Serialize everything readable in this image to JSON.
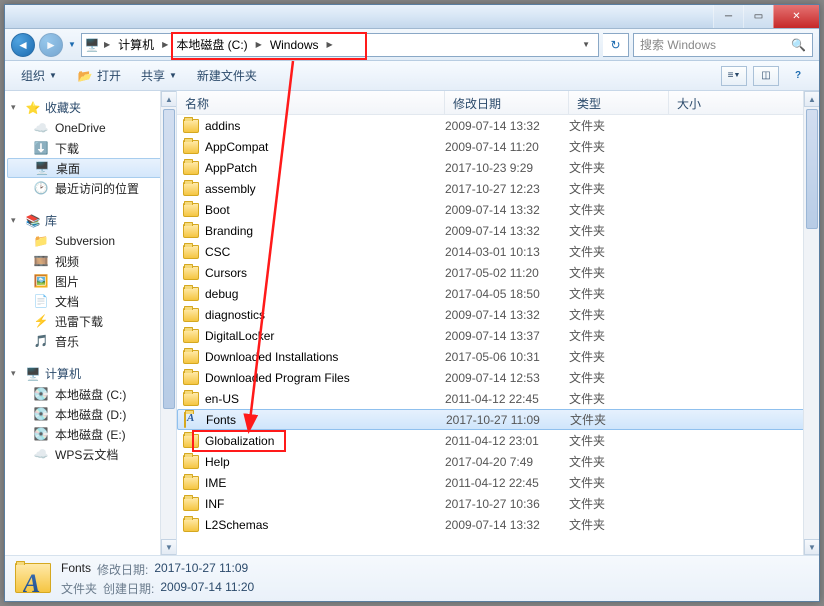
{
  "breadcrumb": {
    "segments": [
      "计算机",
      "本地磁盘 (C:)",
      "Windows"
    ]
  },
  "search": {
    "placeholder": "搜索 Windows"
  },
  "toolbar": {
    "organize": "组织",
    "open": "打开",
    "share": "共享",
    "new_folder": "新建文件夹"
  },
  "sidebar": {
    "favorites": {
      "label": "收藏夹",
      "items": [
        {
          "icon": "cloud",
          "label": "OneDrive"
        },
        {
          "icon": "download",
          "label": "下载"
        },
        {
          "icon": "desktop",
          "label": "桌面",
          "selected": true
        },
        {
          "icon": "recent",
          "label": "最近访问的位置"
        }
      ]
    },
    "libraries": {
      "label": "库",
      "items": [
        {
          "icon": "svn",
          "label": "Subversion"
        },
        {
          "icon": "video",
          "label": "视频"
        },
        {
          "icon": "pictures",
          "label": "图片"
        },
        {
          "icon": "docs",
          "label": "文档"
        },
        {
          "icon": "thunder",
          "label": "迅雷下载"
        },
        {
          "icon": "music",
          "label": "音乐"
        }
      ]
    },
    "computer": {
      "label": "计算机",
      "items": [
        {
          "icon": "drive",
          "label": "本地磁盘 (C:)"
        },
        {
          "icon": "drive",
          "label": "本地磁盘 (D:)"
        },
        {
          "icon": "drive",
          "label": "本地磁盘 (E:)"
        },
        {
          "icon": "wps",
          "label": "WPS云文档"
        }
      ]
    }
  },
  "columns": {
    "name": "名称",
    "date": "修改日期",
    "type": "类型",
    "size": "大小"
  },
  "type_folder": "文件夹",
  "rows": [
    {
      "name": "addins",
      "date": "2009-07-14 13:32"
    },
    {
      "name": "AppCompat",
      "date": "2009-07-14 11:20"
    },
    {
      "name": "AppPatch",
      "date": "2017-10-23 9:29"
    },
    {
      "name": "assembly",
      "date": "2017-10-27 12:23"
    },
    {
      "name": "Boot",
      "date": "2009-07-14 13:32"
    },
    {
      "name": "Branding",
      "date": "2009-07-14 13:32"
    },
    {
      "name": "CSC",
      "date": "2014-03-01 10:13"
    },
    {
      "name": "Cursors",
      "date": "2017-05-02 11:20"
    },
    {
      "name": "debug",
      "date": "2017-04-05 18:50"
    },
    {
      "name": "diagnostics",
      "date": "2009-07-14 13:32"
    },
    {
      "name": "DigitalLocker",
      "date": "2009-07-14 13:37"
    },
    {
      "name": "Downloaded Installations",
      "date": "2017-05-06 10:31"
    },
    {
      "name": "Downloaded Program Files",
      "date": "2009-07-14 12:53"
    },
    {
      "name": "en-US",
      "date": "2011-04-12 22:45"
    },
    {
      "name": "Fonts",
      "date": "2017-10-27 11:09",
      "selected": true,
      "font_icon": true
    },
    {
      "name": "Globalization",
      "date": "2011-04-12 23:01"
    },
    {
      "name": "Help",
      "date": "2017-04-20 7:49"
    },
    {
      "name": "IME",
      "date": "2011-04-12 22:45"
    },
    {
      "name": "INF",
      "date": "2017-10-27 10:36"
    },
    {
      "name": "L2Schemas",
      "date": "2009-07-14 13:32"
    }
  ],
  "details": {
    "name": "Fonts",
    "mod_label": "修改日期:",
    "mod_value": "2017-10-27 11:09",
    "type_label": "文件夹",
    "created_label": "创建日期:",
    "created_value": "2009-07-14 11:20"
  }
}
